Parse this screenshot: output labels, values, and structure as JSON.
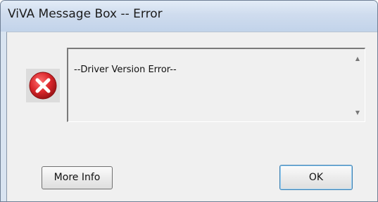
{
  "window": {
    "title": "ViVA Message Box -- Error"
  },
  "message": {
    "text": "--Driver Version Error--",
    "icon": "error-icon"
  },
  "buttons": {
    "more_info_label": "More Info",
    "ok_label": "OK"
  },
  "colors": {
    "error_red": "#d9262b",
    "titlebar": "#cfdcee",
    "dialog_bg": "#f0f0f0"
  }
}
